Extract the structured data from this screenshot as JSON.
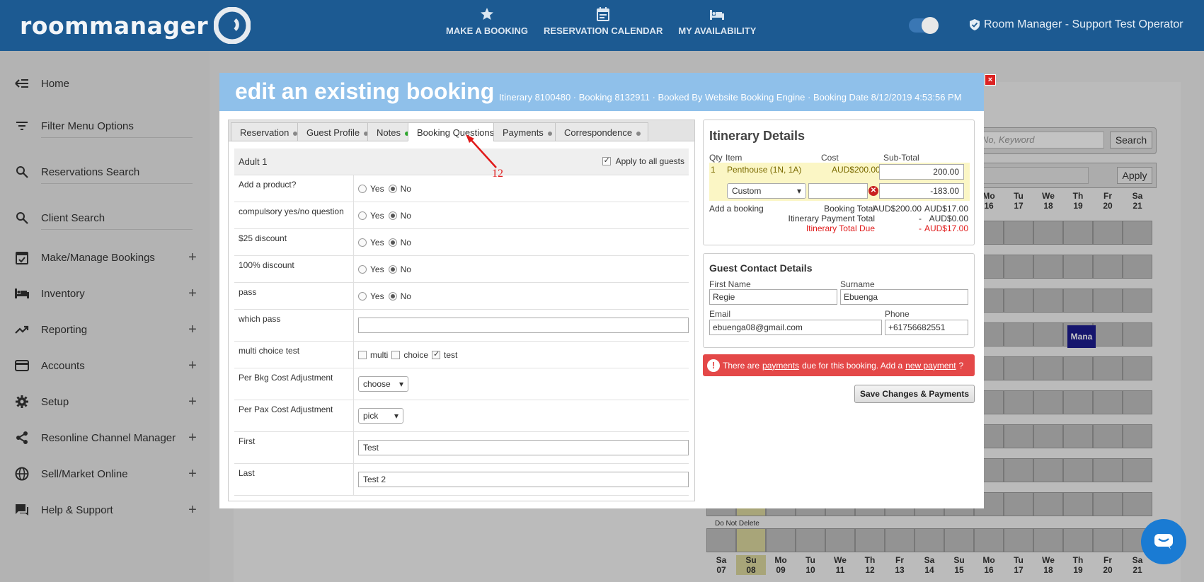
{
  "topbar": {
    "logo_text": "roommanager",
    "nav": [
      {
        "label": "MAKE A BOOKING",
        "icon": "star-icon"
      },
      {
        "label": "RESERVATION CALENDAR",
        "icon": "calendar-icon"
      },
      {
        "label": "MY AVAILABILITY",
        "icon": "bed-icon"
      }
    ],
    "operator": "Room Manager - Support Test Operator"
  },
  "sidebar": {
    "items": [
      {
        "label": "Home",
        "icon": "home-arrow-icon",
        "expandable": false
      },
      {
        "label": "Filter Menu Options",
        "icon": "filter-icon",
        "expandable": false
      },
      {
        "label": "Reservations Search",
        "icon": "search-icon",
        "expandable": false
      },
      {
        "label": "Client Search",
        "icon": "search-icon",
        "expandable": false
      },
      {
        "label": "Make/Manage Bookings",
        "icon": "calendar-check-icon",
        "expandable": true
      },
      {
        "label": "Inventory",
        "icon": "bed-icon",
        "expandable": true
      },
      {
        "label": "Reporting",
        "icon": "trending-icon",
        "expandable": true
      },
      {
        "label": "Accounts",
        "icon": "credit-card-icon",
        "expandable": true
      },
      {
        "label": "Setup",
        "icon": "gear-icon",
        "expandable": true
      },
      {
        "label": "Resonline Channel Manager",
        "icon": "share-icon",
        "expandable": true
      },
      {
        "label": "Sell/Market Online",
        "icon": "globe-icon",
        "expandable": true
      },
      {
        "label": "Help & Support",
        "icon": "chat-icon",
        "expandable": true
      }
    ],
    "plus": "+"
  },
  "background": {
    "search_placeholder": "No, Keyword",
    "search_button": "Search",
    "apply_button": "Apply",
    "calendar_days_top": [
      {
        "d": "Mo",
        "n": "16"
      },
      {
        "d": "Tu",
        "n": "17"
      },
      {
        "d": "We",
        "n": "18"
      },
      {
        "d": "Th",
        "n": "19"
      },
      {
        "d": "Fr",
        "n": "20"
      },
      {
        "d": "Sa",
        "n": "21"
      }
    ],
    "calendar_days_bottom": [
      {
        "d": "Sa",
        "n": "07"
      },
      {
        "d": "Su",
        "n": "08"
      },
      {
        "d": "Mo",
        "n": "09"
      },
      {
        "d": "Tu",
        "n": "10"
      },
      {
        "d": "We",
        "n": "11"
      },
      {
        "d": "Th",
        "n": "12"
      },
      {
        "d": "Fr",
        "n": "13"
      },
      {
        "d": "Sa",
        "n": "14"
      },
      {
        "d": "Su",
        "n": "15"
      },
      {
        "d": "Mo",
        "n": "16"
      },
      {
        "d": "Tu",
        "n": "17"
      },
      {
        "d": "We",
        "n": "18"
      },
      {
        "d": "Th",
        "n": "19"
      },
      {
        "d": "Fr",
        "n": "20"
      },
      {
        "d": "Sa",
        "n": "21"
      }
    ],
    "do_not_delete": "Do Not Delete",
    "mana_label": "Mana"
  },
  "modal": {
    "title": "edit an existing booking",
    "subtitle": "Itinerary 8100480 · Booking 8132911 · Booked By Website Booking Engine · Booking Date 8/12/2019 4:53:56 PM",
    "close": "×",
    "tabs": [
      {
        "label": "Reservation",
        "dot": "grey"
      },
      {
        "label": "Guest Profile",
        "dot": "grey"
      },
      {
        "label": "Notes",
        "dot": "green"
      },
      {
        "label": "Booking Questions",
        "dot": "grey",
        "active": true
      },
      {
        "label": "Payments",
        "dot": "grey"
      },
      {
        "label": "Correspondence",
        "dot": "grey"
      }
    ],
    "questions": {
      "guest_label": "Adult 1",
      "apply_all_label": "Apply to all guests",
      "apply_all_checked": true,
      "yes": "Yes",
      "no": "No",
      "rows": [
        {
          "q": "Add a product?",
          "type": "yesno",
          "value": "No"
        },
        {
          "q": "compulsory yes/no question",
          "type": "yesno",
          "value": "No"
        },
        {
          "q": "$25 discount",
          "type": "yesno",
          "value": "No"
        },
        {
          "q": "100% discount",
          "type": "yesno",
          "value": "No"
        },
        {
          "q": "pass",
          "type": "yesno",
          "value": "No"
        },
        {
          "q": "which pass",
          "type": "text",
          "value": ""
        },
        {
          "q": "multi choice test",
          "type": "multi",
          "options": [
            {
              "label": "multi",
              "checked": false
            },
            {
              "label": "choice",
              "checked": false
            },
            {
              "label": "test",
              "checked": true
            }
          ]
        },
        {
          "q": "Per Bkg Cost Adjustment",
          "type": "select",
          "value": "choose"
        },
        {
          "q": "Per Pax Cost Adjustment",
          "type": "select",
          "value": "pick"
        },
        {
          "q": "First",
          "type": "text",
          "value": "Test"
        },
        {
          "q": "Last",
          "type": "text",
          "value": "Test 2"
        }
      ]
    },
    "annotation_number": "12"
  },
  "itinerary": {
    "title": "Itinerary Details",
    "headers": {
      "qty": "Qty",
      "item": "Item",
      "cost": "Cost",
      "subtotal": "Sub-Total"
    },
    "line": {
      "qty": "1",
      "item": "Penthouse (1N, 1A)",
      "cost": "AUD$200.00",
      "subtotal": "200.00"
    },
    "adjustment": {
      "type": "Custom",
      "amount": "",
      "subtotal": "-183.00"
    },
    "add_booking": "Add a booking",
    "totals": [
      {
        "label": "Booking Total",
        "pre": "AUD$200.00",
        "value": "AUD$17.00",
        "red": false
      },
      {
        "label": "Itinerary Payment Total",
        "pre": "-",
        "value": "AUD$0.00",
        "red": false
      },
      {
        "label": "Itinerary Total Due",
        "pre": "-",
        "value": "AUD$17.00",
        "red": true
      }
    ]
  },
  "guest_contact": {
    "title": "Guest Contact Details",
    "first_name_label": "First Name",
    "first_name": "Regie",
    "surname_label": "Surname",
    "surname": "Ebuenga",
    "email_label": "Email",
    "email": "ebuenga08@gmail.com",
    "phone_label": "Phone",
    "phone": "+61756682551"
  },
  "alert": {
    "pre": "There are",
    "link1": "payments",
    "mid": "due for this booking. Add a",
    "link2": "new payment",
    "post": "?"
  },
  "save_button": "Save Changes & Payments"
}
